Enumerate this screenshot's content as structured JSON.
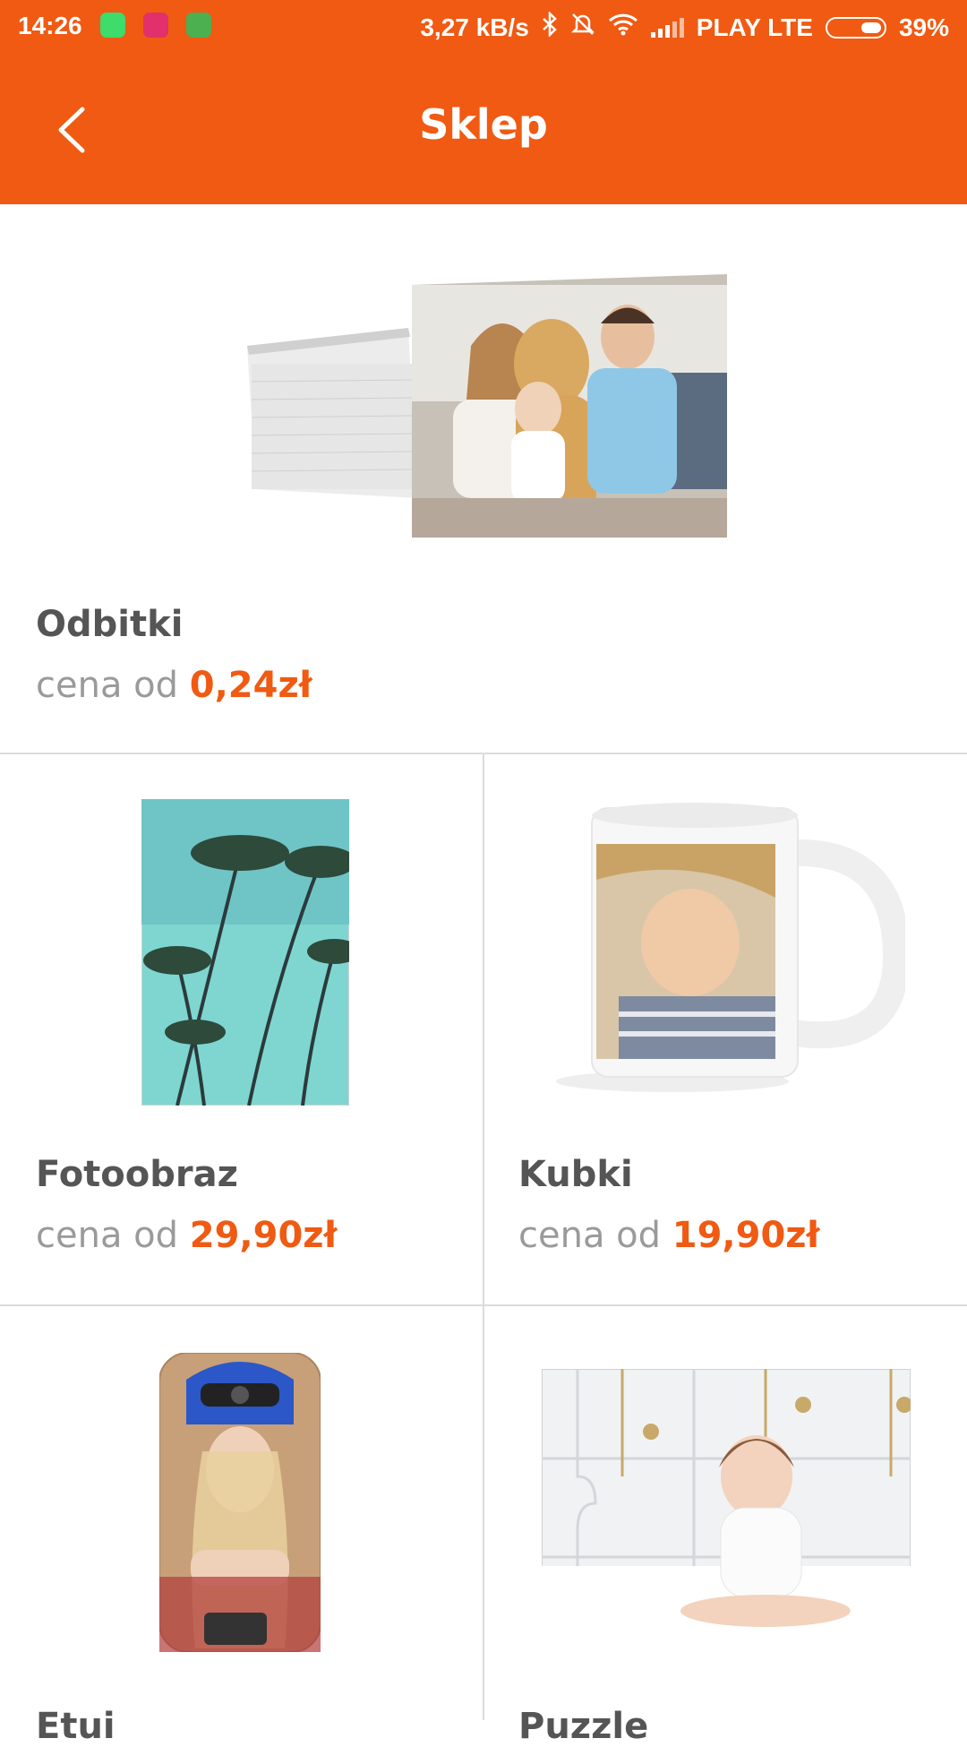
{
  "status_bar": {
    "time": "14:26",
    "app_icons": [
      "whatsapp-icon",
      "instagram-icon",
      "maps-icon"
    ],
    "net_speed": "3,27 kB/s",
    "carrier": "PLAY LTE",
    "battery": "39%",
    "battery_level": 0.39
  },
  "header": {
    "title": "Sklep",
    "back_icon": "back-arrow-icon"
  },
  "colors": {
    "brand": "#f05a12",
    "name": "#555555",
    "muted": "#9a9a9a",
    "divider": "#dcdcdc"
  },
  "products": [
    {
      "name": "Odbitki",
      "price_prefix": "cena od",
      "price": "0,24zł",
      "image": "photo-prints-image"
    },
    {
      "name": "Fotoobraz",
      "price_prefix": "cena od",
      "price": "29,90zł",
      "image": "photo-canvas-image"
    },
    {
      "name": "Kubki",
      "price_prefix": "cena od",
      "price": "19,90zł",
      "image": "mug-image"
    },
    {
      "name": "Etui",
      "image": "phone-case-image"
    },
    {
      "name": "Puzzle",
      "image": "puzzle-image"
    }
  ]
}
